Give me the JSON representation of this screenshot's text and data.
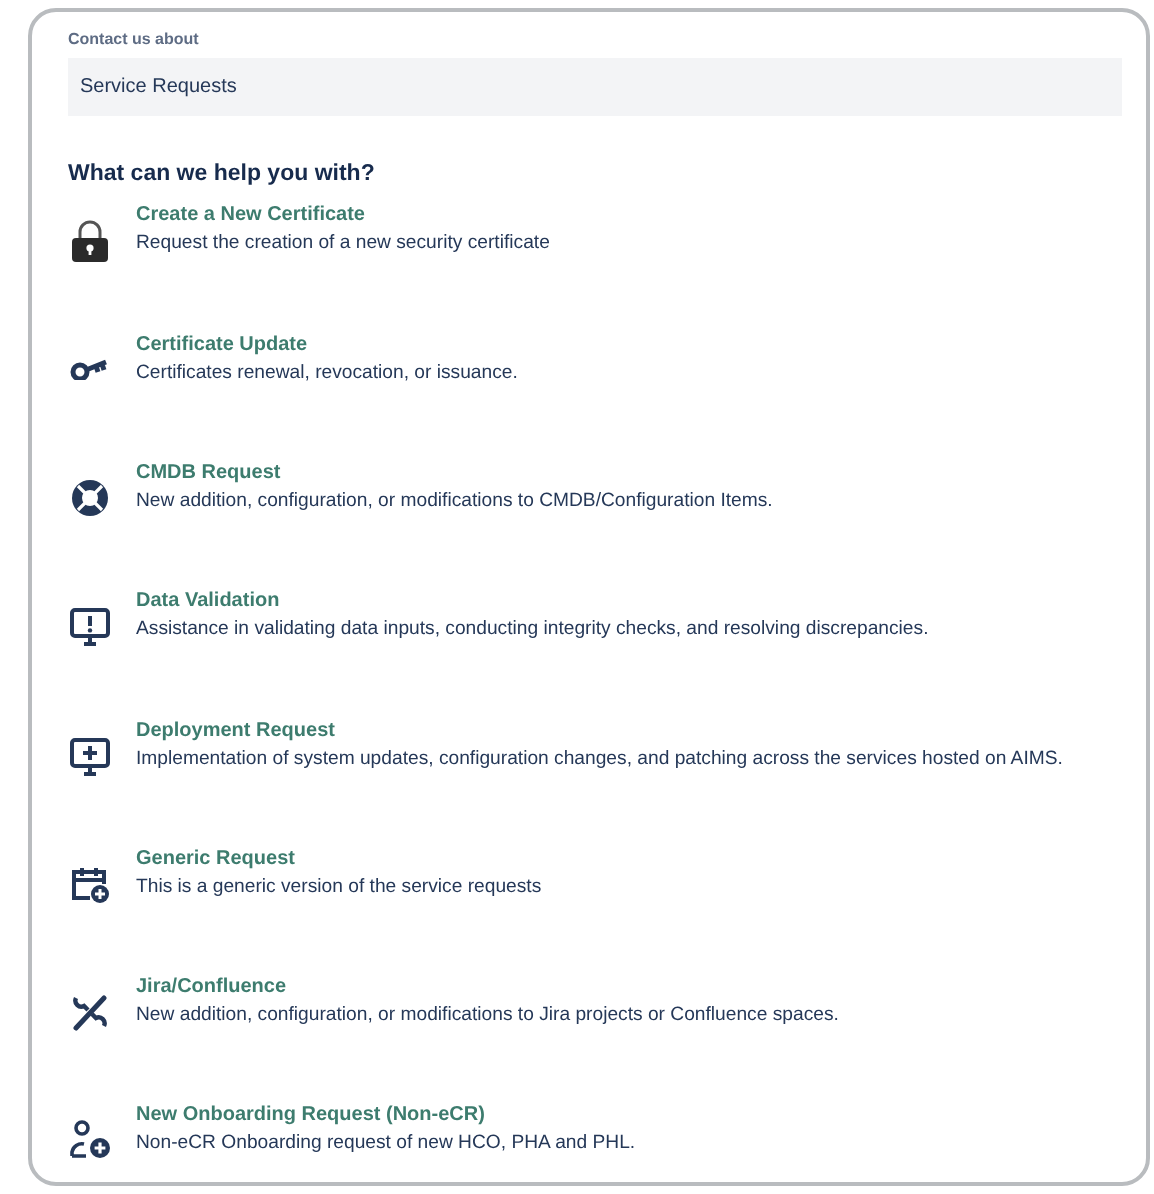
{
  "contact": {
    "label": "Contact us about",
    "value": "Service Requests"
  },
  "heading": "What can we help you with?",
  "requests": [
    {
      "kind": "lock",
      "title": "Create a New Certificate",
      "description": "Request the creation of a new security certificate"
    },
    {
      "kind": "key",
      "title": "Certificate Update",
      "description": "Certificates renewal, revocation, or issuance."
    },
    {
      "kind": "lifebuoy",
      "title": "CMDB Request",
      "description": "New addition, configuration, or modifications to CMDB/Configuration Items."
    },
    {
      "kind": "monitor-alert",
      "title": "Data Validation",
      "description": "Assistance in validating data inputs, conducting integrity checks, and resolving discrepancies."
    },
    {
      "kind": "monitor-plus",
      "title": "Deployment Request",
      "description": "Implementation of system updates, configuration changes, and patching across the services hosted on AIMS."
    },
    {
      "kind": "calendar-plus",
      "title": "Generic Request",
      "description": "This is a generic version of the service requests"
    },
    {
      "kind": "tools",
      "title": "Jira/Confluence",
      "description": "New addition, configuration, or modifications to Jira projects or Confluence spaces."
    },
    {
      "kind": "user-plus",
      "title": "New Onboarding Request (Non-eCR)",
      "description": "Non-eCR Onboarding request of new HCO, PHA and PHL."
    }
  ]
}
